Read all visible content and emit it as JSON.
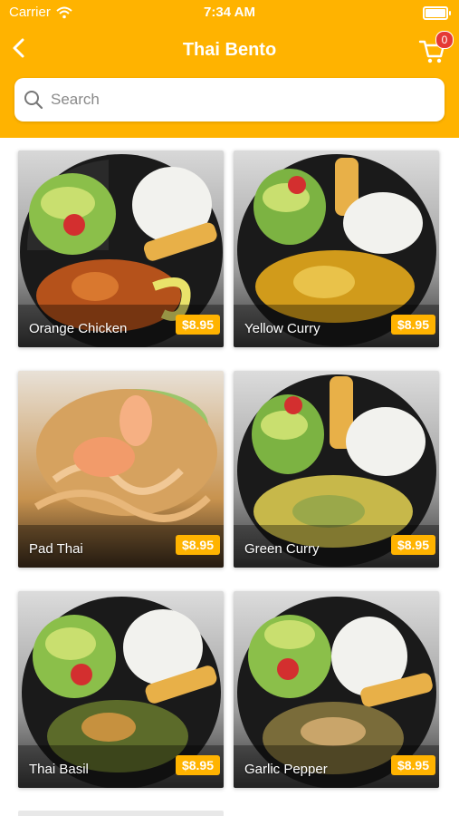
{
  "status": {
    "carrier": "Carrier",
    "time": "7:34 AM"
  },
  "header": {
    "title": "Thai Bento",
    "cart_count": "0"
  },
  "search": {
    "placeholder": "Search"
  },
  "items": [
    {
      "name": "Orange Chicken",
      "price": "$8.95"
    },
    {
      "name": "Yellow Curry",
      "price": "$8.95"
    },
    {
      "name": "Pad Thai",
      "price": "$8.95"
    },
    {
      "name": "Green Curry",
      "price": "$8.95"
    },
    {
      "name": "Thai Basil",
      "price": "$8.95"
    },
    {
      "name": "Garlic Pepper",
      "price": "$8.95"
    }
  ],
  "colors": {
    "accent": "#ffb300",
    "badge": "#e53935"
  }
}
